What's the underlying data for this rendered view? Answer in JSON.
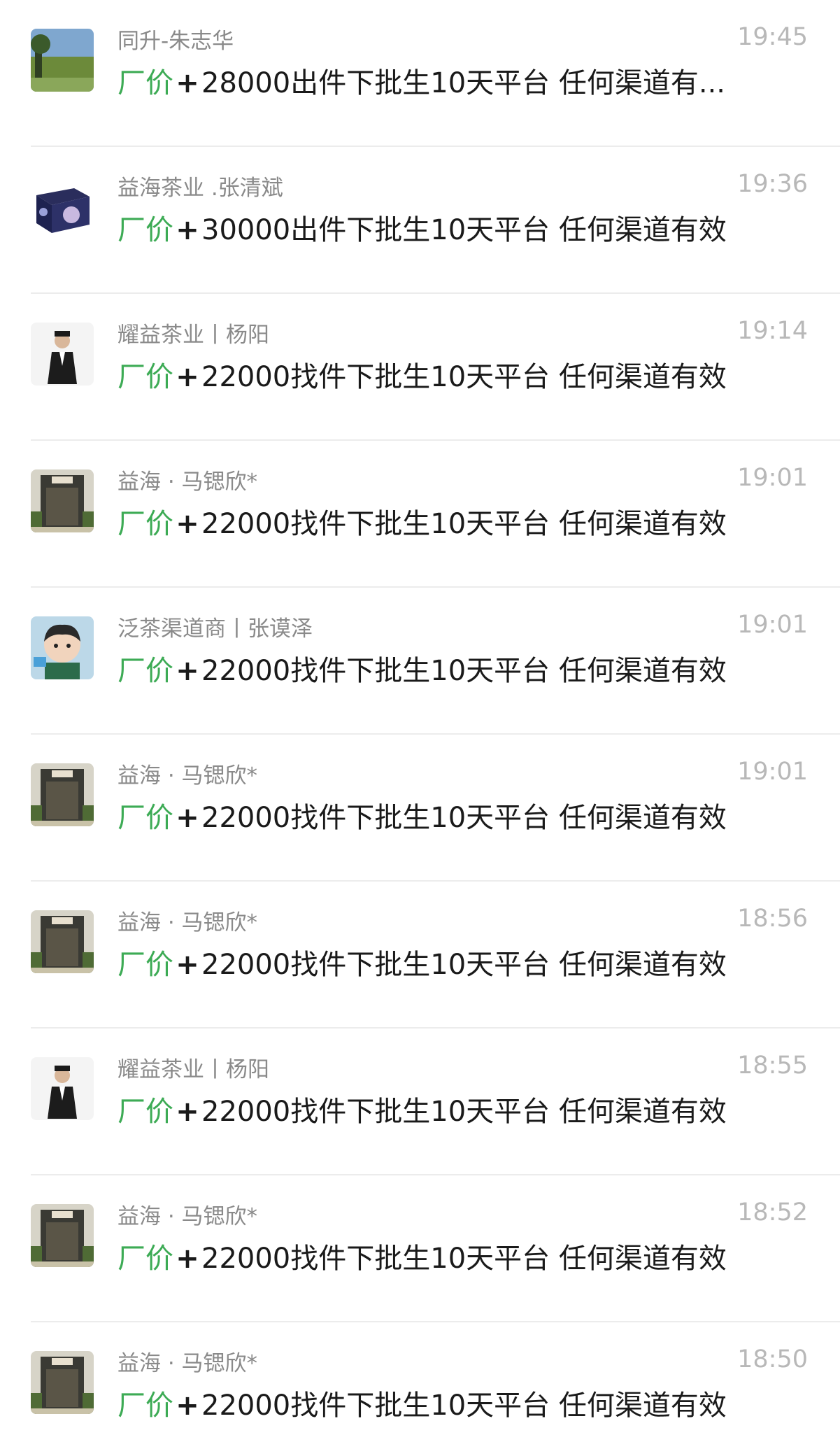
{
  "chats": [
    {
      "avatar": "landscape-avatar",
      "name": "同升-朱志华",
      "time": "19:45",
      "tag": "厂价",
      "plus": "+",
      "text": "28000出件下批生10天平台 任何渠道有..."
    },
    {
      "avatar": "tea-box-avatar",
      "name": "益海茶业 .张清斌",
      "time": "19:36",
      "tag": "厂价",
      "plus": "+",
      "text": "30000出件下批生10天平台   任何渠道有效"
    },
    {
      "avatar": "man-suit-avatar",
      "name": "耀益茶业丨杨阳",
      "time": "19:14",
      "tag": "厂价",
      "plus": "+",
      "text": "22000找件下批生10天平台   任何渠道有效"
    },
    {
      "avatar": "storefront-avatar",
      "name": "益海 · 马锶欣*",
      "time": "19:01",
      "tag": "厂价",
      "plus": "+",
      "text": "22000找件下批生10天平台   任何渠道有效"
    },
    {
      "avatar": "cartoon-boy-avatar",
      "name": "泛茶渠道商丨张谟泽",
      "time": "19:01",
      "tag": "厂价",
      "plus": "+",
      "text": "22000找件下批生10天平台   任何渠道有效"
    },
    {
      "avatar": "storefront-avatar",
      "name": "益海 · 马锶欣*",
      "time": "19:01",
      "tag": "厂价",
      "plus": "+",
      "text": "22000找件下批生10天平台   任何渠道有效"
    },
    {
      "avatar": "storefront-avatar",
      "name": "益海 · 马锶欣*",
      "time": "18:56",
      "tag": "厂价",
      "plus": "+",
      "text": "22000找件下批生10天平台   任何渠道有效"
    },
    {
      "avatar": "man-suit-avatar",
      "name": "耀益茶业丨杨阳",
      "time": "18:55",
      "tag": "厂价",
      "plus": "+",
      "text": "22000找件下批生10天平台   任何渠道有效"
    },
    {
      "avatar": "storefront-avatar",
      "name": "益海 · 马锶欣*",
      "time": "18:52",
      "tag": "厂价",
      "plus": "+",
      "text": "22000找件下批生10天平台   任何渠道有效"
    },
    {
      "avatar": "storefront-avatar",
      "name": "益海 · 马锶欣*",
      "time": "18:50",
      "tag": "厂价",
      "plus": "+",
      "text": "22000找件下批生10天平台   任何渠道有效"
    }
  ]
}
